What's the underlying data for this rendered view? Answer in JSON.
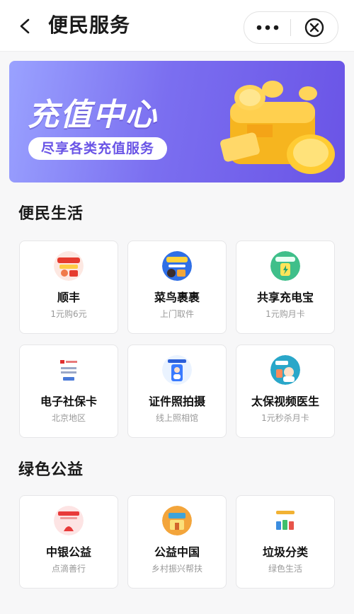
{
  "header": {
    "title": "便民服务",
    "icons": [
      "back-arrow-icon",
      "more-icon",
      "close-icon"
    ]
  },
  "banner": {
    "title": "充值中心",
    "subtitle": "尽享各类充值服务"
  },
  "sections": [
    {
      "title": "便民生活",
      "items": [
        {
          "name": "顺丰",
          "desc": "1元购6元"
        },
        {
          "name": "菜鸟裹裹",
          "desc": "上门取件"
        },
        {
          "name": "共享充电宝",
          "desc": "1元购月卡"
        },
        {
          "name": "电子社保卡",
          "desc": "北京地区"
        },
        {
          "name": "证件照拍摄",
          "desc": "线上照相馆"
        },
        {
          "name": "太保视频医生",
          "desc": "1元秒杀月卡"
        }
      ]
    },
    {
      "title": "绿色公益",
      "items": [
        {
          "name": "中银公益",
          "desc": "点滴善行"
        },
        {
          "name": "公益中国",
          "desc": "乡村振兴帮扶"
        },
        {
          "name": "垃圾分类",
          "desc": "绿色生活"
        }
      ]
    }
  ],
  "colors": {
    "accent": "#6a55e6",
    "banner_start": "#9aa2ff",
    "banner_end": "#6a54e6",
    "page_bg": "#f7f7f8",
    "muted_text": "#9a9a9a"
  }
}
